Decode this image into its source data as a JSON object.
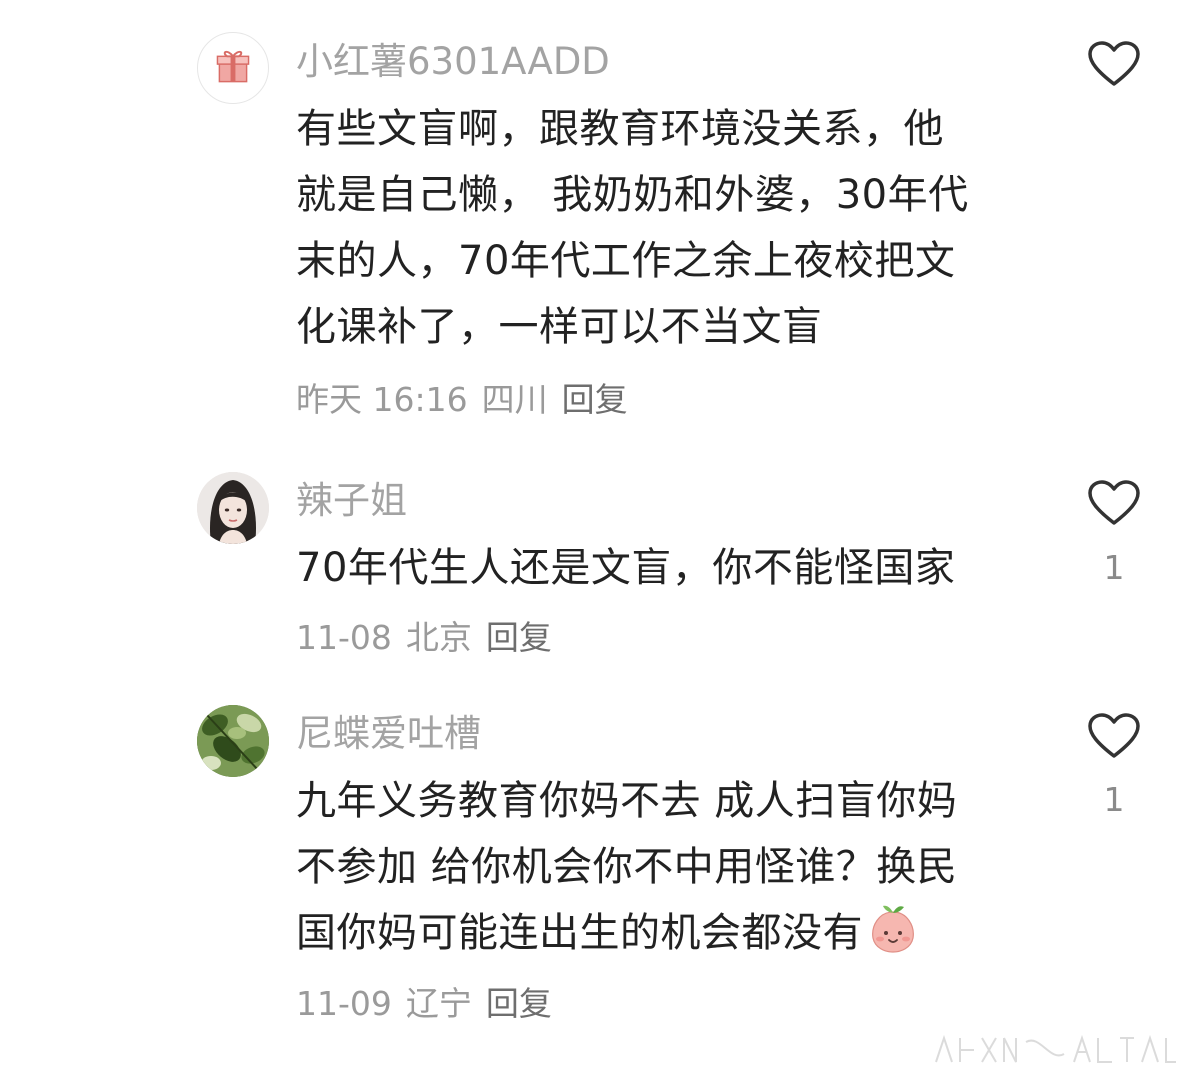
{
  "comments": [
    {
      "username": "小红薯6301AADD",
      "avatar_icon": "gift-icon",
      "content_lines": [
        "有些文盲啊，跟教育环境没关系，他",
        "就是自己懒， 我奶奶和外婆，30年代",
        "末的人，70年代工作之余上夜校把文",
        "化课补了，一样可以不当文盲"
      ],
      "time": "昨天 16:16",
      "location": "四川",
      "reply_label": "回复",
      "like_count": ""
    },
    {
      "username": "辣子姐",
      "avatar_icon": "woman-portrait-avatar",
      "content_lines": [
        "70年代生人还是文盲，你不能怪国家"
      ],
      "time": "11-08",
      "location": "北京",
      "reply_label": "回复",
      "like_count": "1"
    },
    {
      "username": "尼蝶爱吐槽",
      "avatar_icon": "green-leaves-avatar",
      "content_lines": [
        "九年义务教育你妈不去 成人扫盲你妈",
        "不参加 给你机会你不中用怪谁？换民",
        "国你妈可能连出生的机会都没有"
      ],
      "content_emoji": "peach-face-emoji",
      "time": "11-09",
      "location": "辽宁",
      "reply_label": "回复",
      "like_count": "1"
    }
  ],
  "colors": {
    "username": "#a3a3a3",
    "text": "#222222",
    "meta": "#9a9a9a",
    "heart_outline": "#333333"
  }
}
